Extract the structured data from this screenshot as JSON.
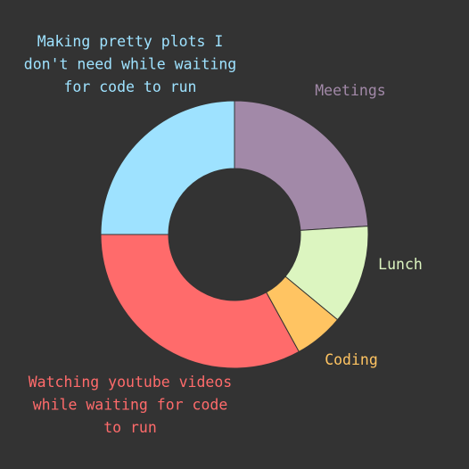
{
  "background": "#333333",
  "chart_data": {
    "type": "pie",
    "donut": true,
    "start": "top",
    "direction": "clockwise",
    "slices": [
      {
        "label": "Meetings",
        "value": 24,
        "color": "#a289a8"
      },
      {
        "label": "Lunch",
        "value": 12,
        "color": "#dcf5c0"
      },
      {
        "label": "Coding",
        "value": 6,
        "color": "#ffc462"
      },
      {
        "label": "Watching youtube videos while waiting for code to run",
        "value": 33,
        "color": "#ff6b6b"
      },
      {
        "label": "Making pretty plots I don't need while waiting for code to run",
        "value": 25,
        "color": "#9ee2ff"
      }
    ],
    "labels": [
      {
        "lines": [
          "Meetings"
        ]
      },
      {
        "lines": [
          "Lunch"
        ]
      },
      {
        "lines": [
          "Coding"
        ]
      },
      {
        "lines": [
          "Watching youtube videos",
          "while waiting for code",
          "to run"
        ]
      },
      {
        "lines": [
          "Making pretty plots I",
          "don't need while waiting",
          "for code to run"
        ]
      }
    ]
  }
}
